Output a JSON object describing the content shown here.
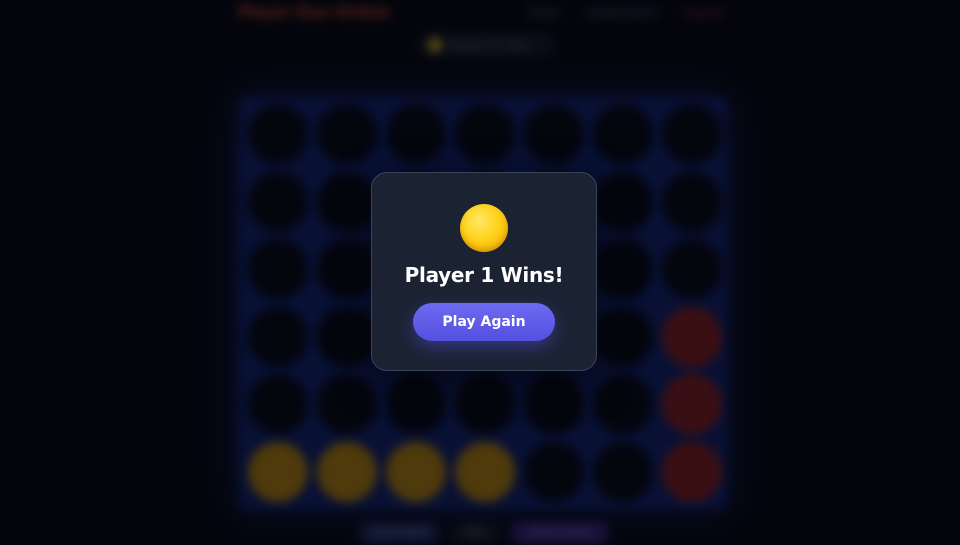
{
  "background_app": {
    "brand": "Player Duo Online",
    "nav": [
      "Rules",
      "Leaderboard",
      "Logout"
    ],
    "turn_indicator": "Player 1's Turn",
    "footer_buttons": [
      "Undo Move",
      "Exit",
      "Swap Colors"
    ],
    "board": {
      "columns": 7,
      "rows": 6,
      "grid": [
        [
          "empty",
          "empty",
          "empty",
          "empty",
          "empty",
          "empty",
          "empty"
        ],
        [
          "empty",
          "empty",
          "empty",
          "empty",
          "empty",
          "empty",
          "empty"
        ],
        [
          "empty",
          "empty",
          "empty",
          "empty",
          "empty",
          "empty",
          "empty"
        ],
        [
          "empty",
          "empty",
          "empty",
          "empty",
          "empty",
          "empty",
          "red"
        ],
        [
          "empty",
          "empty",
          "empty",
          "empty",
          "empty",
          "empty",
          "red"
        ],
        [
          "yellow",
          "yellow",
          "yellow",
          "yellow",
          "empty",
          "empty",
          "red"
        ]
      ]
    }
  },
  "modal": {
    "winner_token_icon": "yellow-disc",
    "title": "Player 1 Wins!",
    "play_again_label": "Play Again"
  },
  "colors": {
    "background": "#04060d",
    "modal_bg": "#1b2333",
    "button_accent": "#5b58e8",
    "yellow_disc": "#ffd21a",
    "red_disc": "#8a1e1e",
    "board": "#10226e"
  }
}
